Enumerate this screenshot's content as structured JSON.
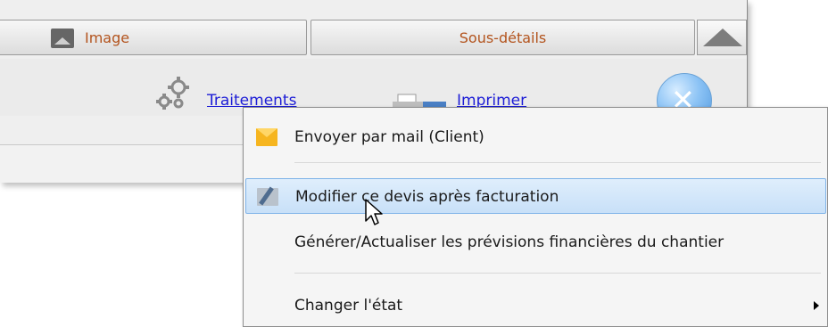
{
  "tabs": {
    "image_label": "Image",
    "sous_details_label": "Sous-détails"
  },
  "toolbar": {
    "traitements_label": "Traitements",
    "imprimer_label": "Imprimer",
    "close_glyph": "✕"
  },
  "context_menu": {
    "items": [
      {
        "label": "Envoyer par mail (Client)",
        "icon": "mail-icon"
      },
      {
        "label": "Modifier ce devis après facturation",
        "icon": "edit-icon",
        "highlighted": true
      },
      {
        "label": "Générer/Actualiser les prévisions financières du chantier"
      },
      {
        "label": "Changer l'état",
        "has_submenu": true
      }
    ]
  },
  "colors": {
    "tab_text": "#b3541e",
    "link": "#1c1cd6",
    "highlight": "#cde4fb",
    "highlight_border": "#7fb3e8"
  }
}
